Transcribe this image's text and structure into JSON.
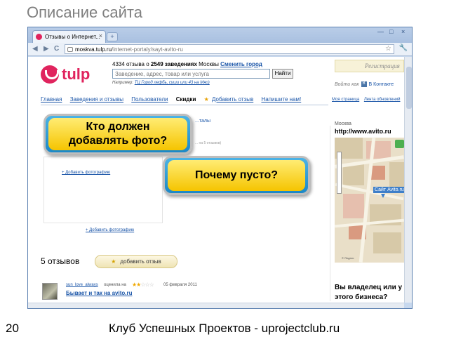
{
  "slide": {
    "title": "Описание сайта",
    "number": "20",
    "footer": "Клуб Успешных Проектов - uprojectclub.ru"
  },
  "browser": {
    "tab_title": "Отзывы о Интернет...",
    "tab_close": "×",
    "new_tab": "+",
    "win_min": "—",
    "win_max": "□",
    "win_close": "×",
    "back": "◀",
    "forward": "▶",
    "reload": "C",
    "url_host": "moskva.tulp.ru",
    "url_path": "/internet-portaly/sayt-avito-ru"
  },
  "site": {
    "logo_text": "tulp",
    "count_prefix": "4334 отзыва о",
    "count_bold": "2549 заведениях",
    "count_city": "Москвы",
    "change_city": "Сменить город",
    "search_placeholder": "Заведение, адрес, товар или услуга",
    "search_button": "Найти",
    "hint_prefix": "Например:",
    "hint_links": "ТЦ Город лефбь, суши или 43 на Мяо)",
    "register": "Регистрация",
    "login_prefix": "Войти как",
    "login_vk": "В Контакте",
    "vk_letter": "B"
  },
  "nav": {
    "items": [
      "Главная",
      "Заведения и отзывы",
      "Пользователи"
    ],
    "active": "Скидки",
    "star": "★",
    "add_review": "Добавить отзыв",
    "write_us": "Напишите нам!",
    "right_items": [
      "Моя страница",
      "Лента обновлений"
    ]
  },
  "content": {
    "blurred_link": "...талы",
    "blurred_note": "... на 5 отзывов)",
    "add_photo": "+ Добавить фотографию",
    "add_photo_2": "+ Добавить фотографию",
    "reviews_count": "5 отзывов",
    "add_review_button_star": "★",
    "add_review_button": "добавить отзыв"
  },
  "review": {
    "user": "sun_love_always",
    "rated": "оценила на",
    "stars_on": "★★",
    "stars_off": "☆☆☆",
    "rating": 2,
    "date": "05 февраля 2011",
    "title": "Бывает и так на avito.ru"
  },
  "map": {
    "city": "Москва",
    "url": "http://www.avito.ru",
    "label": "Сайт Avito.ru",
    "copyright": "© Яндекс"
  },
  "owner": {
    "line1": "Вы владелец или у",
    "line2": "этого бизнеса?"
  },
  "callouts": {
    "who_line1": "Кто должен",
    "who_line2": "добавлять фото?",
    "why": "Почему пусто?"
  }
}
